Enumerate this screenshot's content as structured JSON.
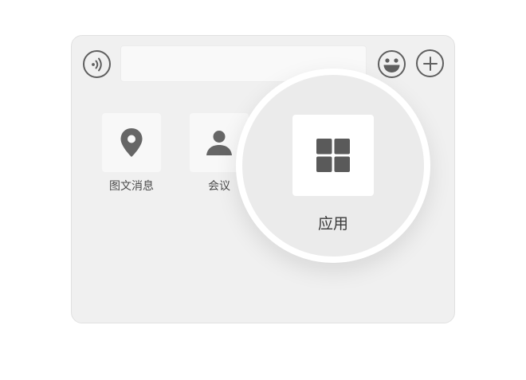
{
  "composer": {
    "voice_icon": "voice-input-icon",
    "emoji_icon": "emoji-icon",
    "plus_icon": "plus-icon",
    "input_value": "",
    "input_placeholder": ""
  },
  "apps": [
    {
      "label": "图文消息",
      "icon": "location-pin-icon"
    },
    {
      "label": "会议",
      "icon": "person-icon"
    }
  ],
  "magnified": {
    "label": "应用",
    "icon": "apps-grid-icon"
  },
  "colors": {
    "panel_bg": "#f0f0f0",
    "icon": "#5f5f5f",
    "tile_bg": "#f8f8f8",
    "magnifier_bg": "#ebebeb"
  }
}
